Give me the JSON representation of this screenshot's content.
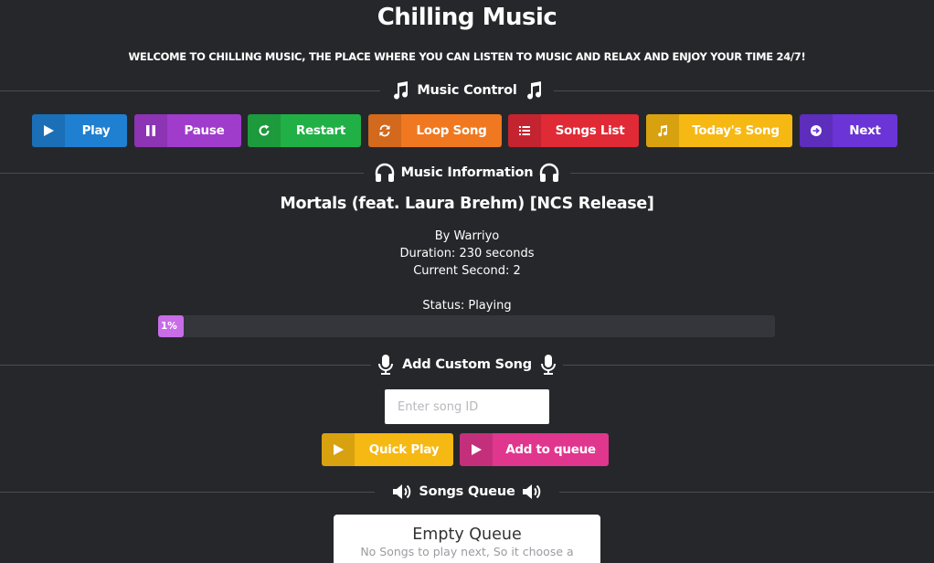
{
  "app": {
    "title": "Chilling Music",
    "welcome": "WELCOME TO CHILLING MUSIC, THE PLACE WHERE YOU CAN LISTEN TO MUSIC AND RELAX AND ENJOY YOUR TIME 24/7!"
  },
  "sections": {
    "music_control": "Music Control",
    "music_information": "Music Information",
    "add_custom_song": "Add Custom Song",
    "songs_queue": "Songs Queue"
  },
  "controls": [
    {
      "id": "play",
      "label": "Play",
      "icon": "play-icon",
      "color": "#1f7fd0"
    },
    {
      "id": "pause",
      "label": "Pause",
      "icon": "pause-icon",
      "color": "#a03ccc"
    },
    {
      "id": "restart",
      "label": "Restart",
      "icon": "restart-icon",
      "color": "#20b045"
    },
    {
      "id": "loop",
      "label": "Loop Song",
      "icon": "loop-icon",
      "color": "#f07820"
    },
    {
      "id": "songs-list",
      "label": "Songs List",
      "icon": "list-icon",
      "color": "#e02a36"
    },
    {
      "id": "todays-song",
      "label": "Today's Song",
      "icon": "music-note-icon",
      "color": "#f6b812"
    },
    {
      "id": "next",
      "label": "Next",
      "icon": "arrow-right-circle-icon",
      "color": "#6a34d6"
    }
  ],
  "now_playing": {
    "title": "Mortals (feat. Laura Brehm) [NCS Release]",
    "artist": "By Warriyo",
    "duration": "Duration: 230 seconds",
    "current_second": "Current Second: 2",
    "status": "Status: Playing",
    "progress_label": "1%",
    "progress_fraction": 0.01
  },
  "custom_song": {
    "placeholder": "Enter song ID",
    "value": "",
    "quick_play_label": "Quick Play",
    "quick_play_color": "#f6b812",
    "add_queue_label": "Add to queue",
    "add_queue_color": "#e0368e"
  },
  "queue": {
    "title": "Empty Queue",
    "subtitle": "No Songs to play next, So it choose a"
  },
  "colors": {
    "background": "#26272b",
    "progress": "#c86ce8"
  }
}
